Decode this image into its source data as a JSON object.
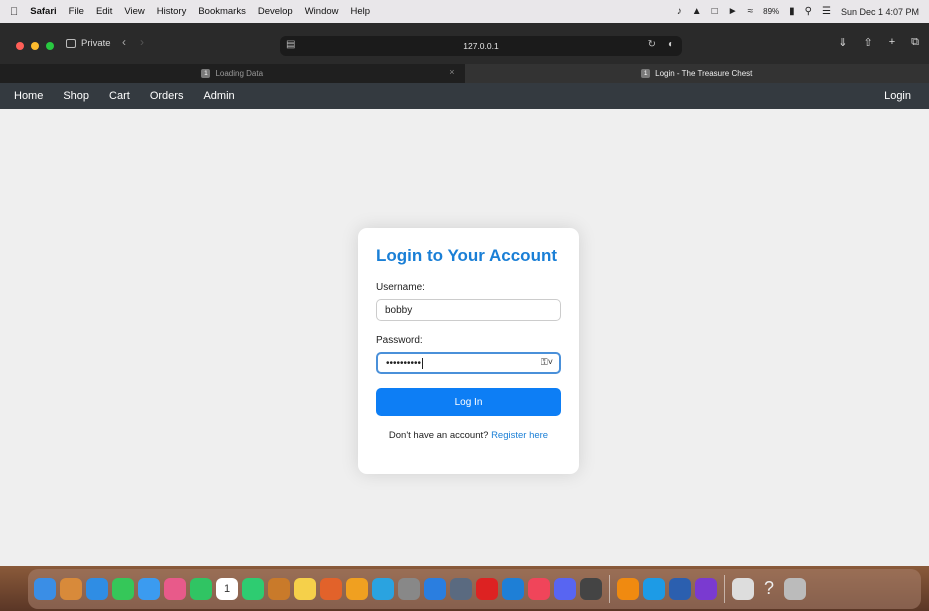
{
  "menubar": {
    "app": "Safari",
    "items": [
      "File",
      "Edit",
      "View",
      "History",
      "Bookmarks",
      "Develop",
      "Window",
      "Help"
    ],
    "battery": "89%",
    "datetime": "Sun Dec 1  4:07 PM"
  },
  "toolbar": {
    "private_label": "Private",
    "url": "127.0.0.1"
  },
  "tabs": [
    {
      "label": "Loading Data",
      "badge": "1"
    },
    {
      "label": "Login - The Treasure Chest",
      "badge": "1"
    }
  ],
  "sitenav": {
    "links": [
      "Home",
      "Shop",
      "Cart",
      "Orders",
      "Admin"
    ],
    "login": "Login"
  },
  "login_form": {
    "title": "Login to Your Account",
    "username_label": "Username:",
    "username_value": "bobby",
    "password_label": "Password:",
    "password_value": "••••••••••",
    "submit": "Log In",
    "register_prompt": "Don't have an account?",
    "register_link": "Register here"
  },
  "colors": {
    "accent": "#0d7ef5",
    "navbar": "#343a40",
    "title": "#1a7fd6"
  },
  "dock": {
    "apps": [
      "finder-icon",
      "launchpad-icon",
      "safari-icon",
      "messages-icon",
      "mail-icon",
      "photos-icon",
      "facetime-icon",
      "calendar-icon",
      "whatsapp-icon",
      "app-icon",
      "notes-icon",
      "matlab-icon",
      "app-icon",
      "telegram-icon",
      "settings-icon",
      "app-icon",
      "app-icon",
      "acrobat-icon",
      "vscode-icon",
      "music-icon",
      "discord-icon",
      "app-icon",
      "vlc-icon",
      "docker-icon",
      "word-icon",
      "github-icon",
      "app-icon",
      "help-icon",
      "trash-icon"
    ],
    "calendar_day": "1"
  }
}
